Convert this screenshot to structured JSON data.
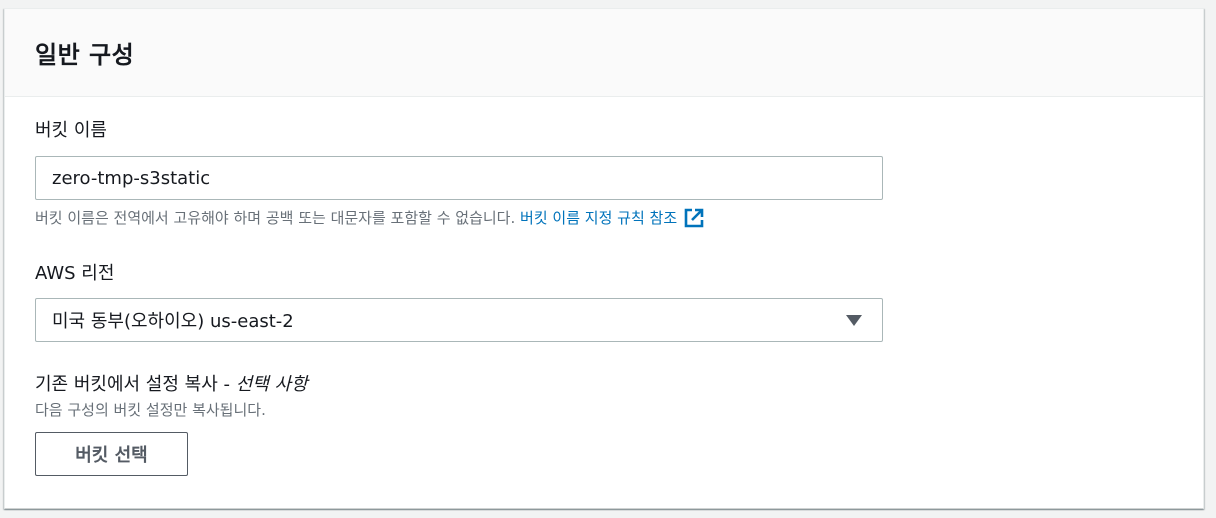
{
  "panel": {
    "title": "일반 구성"
  },
  "bucket_name": {
    "label": "버킷 이름",
    "value": "zero-tmp-s3static",
    "hint": "버킷 이름은 전역에서 고유해야 하며 공백 또는 대문자를 포함할 수 없습니다.",
    "hint_link": "버킷 이름 지정 규칙 참조",
    "link_icon": "external-link-icon"
  },
  "region": {
    "label": "AWS 리전",
    "selected": "미국 동부(오하이오) us-east-2",
    "dropdown_icon": "caret-down-icon"
  },
  "copy_settings": {
    "label": "기존 버킷에서 설정 복사 -",
    "optional": "선택 사항",
    "description": "다음 구성의 버킷 설정만 복사됩니다.",
    "button_label": "버킷 선택"
  },
  "colors": {
    "link": "#0073bb",
    "header_bg": "#fafafa",
    "input_border": "#aab7b8",
    "hint_text": "#687078"
  }
}
